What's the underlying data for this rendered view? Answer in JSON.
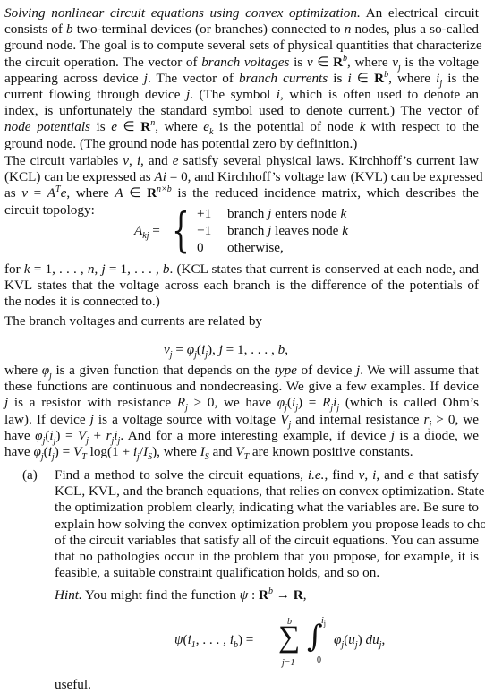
{
  "document": {
    "p1": {
      "lines": [
        {
          "parts": [
            {
              "t": "Solving nonlinear circuit equations using convex optimization.",
              "s": "i"
            },
            {
              "t": " An electrical circuit"
            }
          ]
        },
        {
          "parts": [
            {
              "t": "consists of "
            },
            {
              "t": "b",
              "s": "i"
            },
            {
              "t": " two-terminal devices (or branches) connected to "
            },
            {
              "t": "n",
              "s": "i"
            },
            {
              "t": " nodes, plus a so-called"
            }
          ]
        },
        {
          "parts": [
            {
              "t": "ground node. The goal is to compute several sets of physical quantities that characterize"
            }
          ]
        },
        {
          "parts": [
            {
              "t": "the circuit operation. The vector of "
            },
            {
              "t": "branch voltages",
              "s": "i"
            },
            {
              "t": " is "
            },
            {
              "t": "v",
              "s": "i"
            },
            {
              "t": " ∈ "
            },
            {
              "t": "R",
              "s": "b"
            },
            {
              "t": "b",
              "s": "sup"
            },
            {
              "t": ", where "
            },
            {
              "t": "v",
              "s": "i"
            },
            {
              "t": "j",
              "s": "sub"
            },
            {
              "t": " is the voltage"
            }
          ]
        },
        {
          "parts": [
            {
              "t": "appearing across device "
            },
            {
              "t": "j",
              "s": "i"
            },
            {
              "t": ". The vector of "
            },
            {
              "t": "branch currents",
              "s": "i"
            },
            {
              "t": " is "
            },
            {
              "t": "i",
              "s": "i"
            },
            {
              "t": " ∈ "
            },
            {
              "t": "R",
              "s": "b"
            },
            {
              "t": "b",
              "s": "sup"
            },
            {
              "t": ", where "
            },
            {
              "t": "i",
              "s": "i"
            },
            {
              "t": "j",
              "s": "sub"
            },
            {
              "t": " is the"
            }
          ]
        },
        {
          "parts": [
            {
              "t": "current flowing through device "
            },
            {
              "t": "j",
              "s": "i"
            },
            {
              "t": ". (The symbol "
            },
            {
              "t": "i",
              "s": "i"
            },
            {
              "t": ", which is often used to denote an"
            }
          ]
        },
        {
          "parts": [
            {
              "t": "index, is unfortunately the standard symbol used to denote current.) The vector of"
            }
          ]
        },
        {
          "parts": [
            {
              "t": "node potentials",
              "s": "i"
            },
            {
              "t": " is "
            },
            {
              "t": "e",
              "s": "i"
            },
            {
              "t": " ∈ "
            },
            {
              "t": "R",
              "s": "b"
            },
            {
              "t": "n",
              "s": "sup"
            },
            {
              "t": ", where "
            },
            {
              "t": "e",
              "s": "i"
            },
            {
              "t": "k",
              "s": "sub"
            },
            {
              "t": " is the potential of node "
            },
            {
              "t": "k",
              "s": "i"
            },
            {
              "t": " with respect to the"
            }
          ]
        },
        {
          "parts": [
            {
              "t": "ground node. (The ground node has potential zero by definition.)"
            }
          ],
          "last": true
        }
      ]
    },
    "p2": {
      "lines": [
        {
          "parts": [
            {
              "t": "The circuit variables "
            },
            {
              "t": "v",
              "s": "i"
            },
            {
              "t": ", "
            },
            {
              "t": "i",
              "s": "i"
            },
            {
              "t": ", and "
            },
            {
              "t": "e",
              "s": "i"
            },
            {
              "t": " satisfy several physical laws. Kirchhoff’s current law"
            }
          ]
        },
        {
          "parts": [
            {
              "t": "(KCL) can be expressed as "
            },
            {
              "t": "Ai",
              "s": "i"
            },
            {
              "t": " = 0, and Kirchhoff’s voltage law (KVL) can be expressed"
            }
          ]
        },
        {
          "parts": [
            {
              "t": "as "
            },
            {
              "t": "v",
              "s": "i"
            },
            {
              "t": " = "
            },
            {
              "t": "A",
              "s": "i"
            },
            {
              "t": "T",
              "s": "sup"
            },
            {
              "t": "e",
              "s": "i"
            },
            {
              "t": ", where "
            },
            {
              "t": "A",
              "s": "i"
            },
            {
              "t": " ∈ "
            },
            {
              "t": "R",
              "s": "b"
            },
            {
              "t": "n×b",
              "s": "sup"
            },
            {
              "t": " is the reduced incidence matrix, which describes the"
            }
          ]
        },
        {
          "parts": [
            {
              "t": "circuit topology:"
            }
          ],
          "last": true
        }
      ]
    },
    "cases": {
      "lhs": "A",
      "lhs_sub": "kj",
      "equals": " =",
      "rows": [
        {
          "value": "+1",
          "parts": [
            {
              "t": "branch "
            },
            {
              "t": "j",
              "s": "i"
            },
            {
              "t": " enters node "
            },
            {
              "t": "k",
              "s": "i"
            }
          ]
        },
        {
          "value": "−1",
          "parts": [
            {
              "t": "branch "
            },
            {
              "t": "j",
              "s": "i"
            },
            {
              "t": " leaves node "
            },
            {
              "t": "k",
              "s": "i"
            }
          ]
        },
        {
          "value": "0",
          "parts": [
            {
              "t": "otherwise,"
            }
          ]
        }
      ]
    },
    "p3": {
      "lines": [
        {
          "parts": [
            {
              "t": "for "
            },
            {
              "t": "k",
              "s": "i"
            },
            {
              "t": " = 1, . . . , "
            },
            {
              "t": "n",
              "s": "i"
            },
            {
              "t": ", "
            },
            {
              "t": "j",
              "s": "i"
            },
            {
              "t": " = 1, . . . , "
            },
            {
              "t": "b",
              "s": "i"
            },
            {
              "t": ". (KCL states that current is conserved at each node, and"
            }
          ]
        },
        {
          "parts": [
            {
              "t": "KVL states that the voltage across each branch is the difference of the potentials of"
            }
          ]
        },
        {
          "parts": [
            {
              "t": "the nodes it is connected to.)"
            }
          ],
          "last": true
        }
      ]
    },
    "p4": {
      "lines": [
        {
          "parts": [
            {
              "t": "The branch voltages and currents are related by"
            }
          ],
          "last": true
        }
      ]
    },
    "eq_branch": {
      "parts": [
        {
          "t": "v",
          "s": "i"
        },
        {
          "t": "j",
          "s": "sub"
        },
        {
          "t": " = "
        },
        {
          "t": "φ",
          "s": "i"
        },
        {
          "t": "j",
          "s": "sub"
        },
        {
          "t": "("
        },
        {
          "t": "i",
          "s": "i"
        },
        {
          "t": "j",
          "s": "sub"
        },
        {
          "t": "),     "
        },
        {
          "t": "j",
          "s": "i"
        },
        {
          "t": " = 1, . . . , "
        },
        {
          "t": "b",
          "s": "i"
        },
        {
          "t": ","
        }
      ]
    },
    "p5": {
      "lines": [
        {
          "parts": [
            {
              "t": "where "
            },
            {
              "t": "φ",
              "s": "i"
            },
            {
              "t": "j",
              "s": "sub"
            },
            {
              "t": " is a given function that depends on the "
            },
            {
              "t": "type",
              "s": "i"
            },
            {
              "t": " of device "
            },
            {
              "t": "j",
              "s": "i"
            },
            {
              "t": ". We will assume that"
            }
          ]
        },
        {
          "parts": [
            {
              "t": "these functions are continuous and nondecreasing. We give a few examples. If device"
            }
          ]
        },
        {
          "parts": [
            {
              "t": "j",
              "s": "i"
            },
            {
              "t": " is a resistor with resistance "
            },
            {
              "t": "R",
              "s": "i"
            },
            {
              "t": "j",
              "s": "sub"
            },
            {
              "t": " > 0, we have "
            },
            {
              "t": "φ",
              "s": "i"
            },
            {
              "t": "j",
              "s": "sub"
            },
            {
              "t": "("
            },
            {
              "t": "i",
              "s": "i"
            },
            {
              "t": "j",
              "s": "sub"
            },
            {
              "t": ") = "
            },
            {
              "t": "R",
              "s": "i"
            },
            {
              "t": "j",
              "s": "sub"
            },
            {
              "t": "i",
              "s": "i"
            },
            {
              "t": "j",
              "s": "sub"
            },
            {
              "t": " (which is called Ohm’s"
            }
          ]
        },
        {
          "parts": [
            {
              "t": "law). If device "
            },
            {
              "t": "j",
              "s": "i"
            },
            {
              "t": " is a voltage source with voltage "
            },
            {
              "t": "V",
              "s": "i"
            },
            {
              "t": "j",
              "s": "sub"
            },
            {
              "t": " and internal resistance "
            },
            {
              "t": "r",
              "s": "i"
            },
            {
              "t": "j",
              "s": "sub"
            },
            {
              "t": " > 0, we"
            }
          ]
        },
        {
          "parts": [
            {
              "t": "have "
            },
            {
              "t": "φ",
              "s": "i"
            },
            {
              "t": "j",
              "s": "sub"
            },
            {
              "t": "("
            },
            {
              "t": "i",
              "s": "i"
            },
            {
              "t": "j",
              "s": "sub"
            },
            {
              "t": ") = "
            },
            {
              "t": "V",
              "s": "i"
            },
            {
              "t": "j",
              "s": "sub"
            },
            {
              "t": " + "
            },
            {
              "t": "r",
              "s": "i"
            },
            {
              "t": "j",
              "s": "sub"
            },
            {
              "t": "i",
              "s": "i"
            },
            {
              "t": "j",
              "s": "sub"
            },
            {
              "t": ". And for a more interesting example, if device "
            },
            {
              "t": "j",
              "s": "i"
            },
            {
              "t": " is a diode, we"
            }
          ]
        },
        {
          "parts": [
            {
              "t": "have "
            },
            {
              "t": "φ",
              "s": "i"
            },
            {
              "t": "j",
              "s": "sub"
            },
            {
              "t": "("
            },
            {
              "t": "i",
              "s": "i"
            },
            {
              "t": "j",
              "s": "sub"
            },
            {
              "t": ") = "
            },
            {
              "t": "V",
              "s": "i"
            },
            {
              "t": "T",
              "s": "sub"
            },
            {
              "t": " log(1 + "
            },
            {
              "t": "i",
              "s": "i"
            },
            {
              "t": "j",
              "s": "sub"
            },
            {
              "t": "/"
            },
            {
              "t": "I",
              "s": "i"
            },
            {
              "t": "S",
              "s": "sub"
            },
            {
              "t": "), where "
            },
            {
              "t": "I",
              "s": "i"
            },
            {
              "t": "S",
              "s": "sub"
            },
            {
              "t": " and "
            },
            {
              "t": "V",
              "s": "i"
            },
            {
              "t": "T",
              "s": "sub"
            },
            {
              "t": " are known positive constants."
            }
          ],
          "last": true
        }
      ]
    },
    "item_a": {
      "label": "(a)",
      "lines": [
        {
          "parts": [
            {
              "t": "Find a method to solve the circuit equations, "
            },
            {
              "t": "i.e.",
              "s": "i"
            },
            {
              "t": ", find "
            },
            {
              "t": "v",
              "s": "i"
            },
            {
              "t": ", "
            },
            {
              "t": "i",
              "s": "i"
            },
            {
              "t": ", and "
            },
            {
              "t": "e",
              "s": "i"
            },
            {
              "t": " that satisfy"
            }
          ]
        },
        {
          "parts": [
            {
              "t": "KCL, KVL, and the branch equations, that relies on convex optimization. State"
            }
          ]
        },
        {
          "parts": [
            {
              "t": "the optimization problem clearly, indicating what the variables are. Be sure to"
            }
          ]
        },
        {
          "parts": [
            {
              "t": "explain how solving the convex optimization problem you propose leads to choices"
            }
          ]
        },
        {
          "parts": [
            {
              "t": "of the circuit variables that satisfy all of the circuit equations. You can assume"
            }
          ]
        },
        {
          "parts": [
            {
              "t": "that no pathologies occur in the problem that you propose, for example, it is"
            }
          ]
        },
        {
          "parts": [
            {
              "t": "feasible, a suitable constraint qualification holds, and so on."
            }
          ],
          "last": true
        }
      ],
      "hint": {
        "parts": [
          {
            "t": "Hint.",
            "s": "i"
          },
          {
            "t": " You might find the function "
          },
          {
            "t": "ψ",
            "s": "i"
          },
          {
            "t": " : "
          },
          {
            "t": "R",
            "s": "b"
          },
          {
            "t": "b",
            "s": "sup"
          },
          {
            "t": " → "
          },
          {
            "t": "R",
            "s": "b"
          },
          {
            "t": ","
          }
        ]
      },
      "psi_eq": {
        "lhs": [
          {
            "t": "ψ",
            "s": "i"
          },
          {
            "t": "("
          },
          {
            "t": "i",
            "s": "i"
          },
          {
            "t": "1",
            "s": "sub"
          },
          {
            "t": ", . . . , "
          },
          {
            "t": "i",
            "s": "i"
          },
          {
            "t": "b",
            "s": "sub"
          },
          {
            "t": ") ="
          }
        ],
        "sum_symbol": "∑",
        "sum_upper": "b",
        "sum_lower": "j=1",
        "int_symbol": "∫",
        "int_upper": "i",
        "int_upper_sub": "j",
        "int_lower": "0",
        "integrand": [
          {
            "t": "φ",
            "s": "i"
          },
          {
            "t": "j",
            "s": "sub"
          },
          {
            "t": "("
          },
          {
            "t": "u",
            "s": "i"
          },
          {
            "t": "j",
            "s": "sub"
          },
          {
            "t": ") "
          },
          {
            "t": "du",
            "s": "i"
          },
          {
            "t": "j",
            "s": "sub"
          },
          {
            "t": ","
          }
        ]
      },
      "closing": "useful."
    }
  }
}
